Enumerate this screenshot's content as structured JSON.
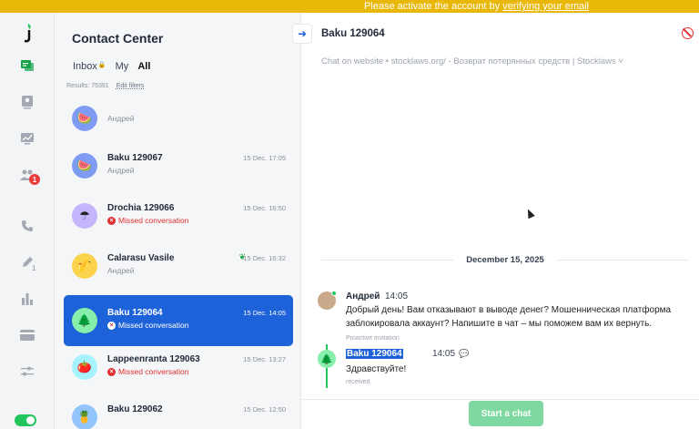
{
  "banner": {
    "text": "Please activate the account by ",
    "link": "verifying your email"
  },
  "rail": {
    "logo": "leaf-logo-icon",
    "items": [
      {
        "icon": "chat-icon"
      },
      {
        "icon": "contact-card-icon"
      },
      {
        "icon": "analytics-icon"
      },
      {
        "icon": "team-icon",
        "badge": "1"
      },
      {
        "icon": "phone-icon"
      },
      {
        "icon": "pencil-icon",
        "count": "1"
      },
      {
        "icon": "bar-chart-icon"
      },
      {
        "icon": "billing-card-icon"
      },
      {
        "icon": "settings-sliders-icon"
      }
    ],
    "toggle_on": true
  },
  "list": {
    "title": "Contact Center",
    "tabs": [
      "Inbox",
      "My",
      "All"
    ],
    "active_tab": "All",
    "results": "Results: 75391",
    "edit_filters": "Edit filters",
    "items": [
      {
        "name": "",
        "sub": "Андрей",
        "time": "",
        "avatar_bg": "#7f9cf5",
        "emoji": "🍉",
        "missed": false
      },
      {
        "name": "Baku 129067",
        "sub": "Андрей",
        "time": "15 Dec. 17:05",
        "avatar_bg": "#7f9cf5",
        "emoji": "🍉",
        "missed": false
      },
      {
        "name": "Drochia 129066",
        "sub": "Missed conversation",
        "time": "15 Dec. 16:50",
        "avatar_bg": "#c4b5fd",
        "emoji": "☂",
        "missed": true
      },
      {
        "name": "Calarasu Vasile",
        "sub": "Андрей",
        "time": "15 Dec. 16:32",
        "avatar_bg": "#fcd34d",
        "emoji": "🎷",
        "missed": false,
        "leaf": true
      },
      {
        "name": "Baku 129064",
        "sub": "Missed conversation",
        "time": "15 Dec. 14:05",
        "avatar_bg": "#86efac",
        "emoji": "🌲",
        "missed": true,
        "selected": true
      },
      {
        "name": "Lappeenranta 129063",
        "sub": "Missed conversation",
        "time": "15 Dec. 13:27",
        "avatar_bg": "#a5f3fc",
        "emoji": "🍅",
        "missed": true
      },
      {
        "name": "Baku 129062",
        "sub": "",
        "time": "15 Dec. 12:50",
        "avatar_bg": "#93c5fd",
        "emoji": "🍍",
        "missed": false
      }
    ]
  },
  "chat": {
    "title": "Baku 129064",
    "subtitle": "Chat on website • stocklaws.org/ - Возврат потерянных средств | Stocklaws ˅",
    "date": "December 15, 2025",
    "messages": [
      {
        "author": "Андрей",
        "time": "14:05",
        "text": "Добрый день! Вам отказывают в выводе денег? Мошенническая платформа заблокировала аккаунт? Напишите в чат – мы поможем вам их вернуть.",
        "status": "Proactive invitation"
      },
      {
        "author": "Baku 129064",
        "time": "14:05",
        "text": "Здравствуйте!",
        "status": "received"
      }
    ],
    "start_button": "Start a chat"
  },
  "colors": {
    "accent": "#1d62d8",
    "banner": "#e9b708",
    "green": "#22c55e",
    "missed": "#e03131"
  }
}
